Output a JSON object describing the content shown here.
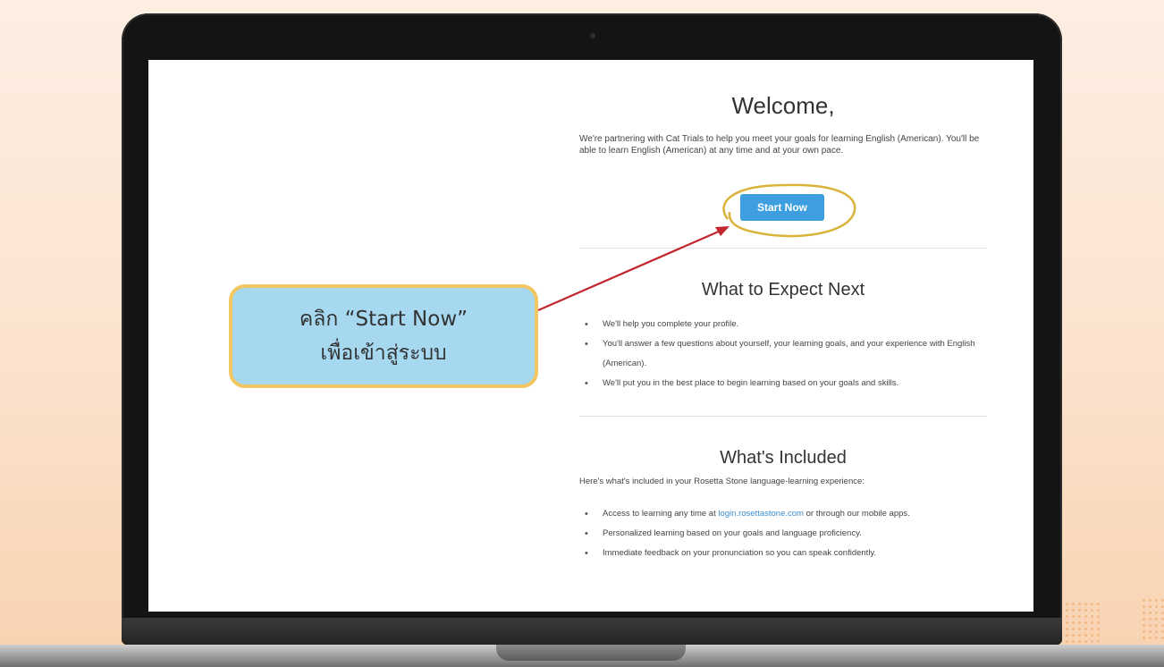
{
  "welcome": {
    "title": "Welcome,",
    "intro": "We're partnering with Cat Trials to help you meet your goals for learning English (American). You'll be able to learn English (American) at any time and at your own pace.",
    "start_button": "Start Now"
  },
  "expect": {
    "title": "What to Expect Next",
    "items": [
      "We'll help you complete your profile.",
      "You'll answer a few questions about yourself, your learning goals, and your experience with English (American).",
      "We'll put you in the best place to begin learning based on your goals and skills."
    ]
  },
  "included": {
    "title": "What's Included",
    "intro": "Here's what's included in your Rosetta Stone language-learning experience:",
    "item1_prefix": "Access to learning any time at ",
    "item1_link": "login.rosettastone.com",
    "item1_suffix": " or through our mobile apps.",
    "item2": "Personalized learning based on your goals and language proficiency.",
    "item3": "Immediate feedback on your pronunciation so you can speak confidently."
  },
  "callout": {
    "line1": "คลิก “Start Now”",
    "line2": "เพื่อเข้าสู่ระบบ"
  },
  "colors": {
    "button": "#3d9ee0",
    "callout_fill": "#a6d8ef",
    "callout_border": "#f2c661",
    "arrow": "#c0262b",
    "highlight_ring": "#d9b33a"
  }
}
